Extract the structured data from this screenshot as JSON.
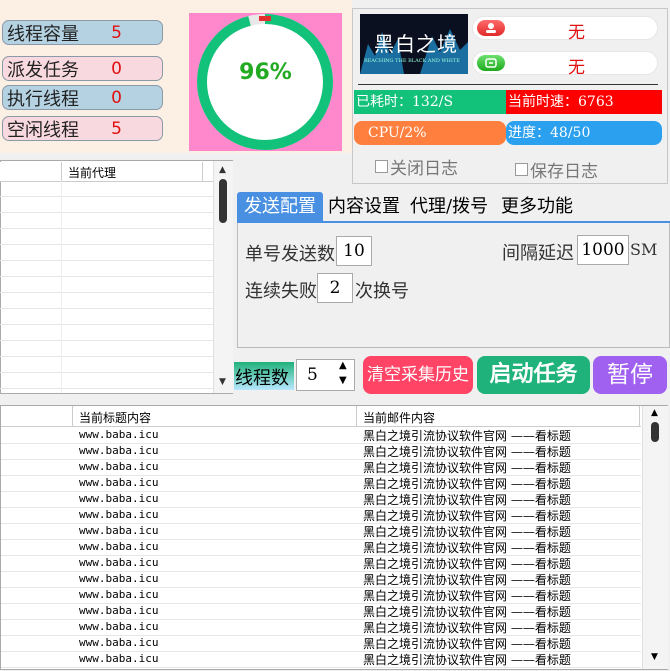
{
  "stats": {
    "capacity": {
      "label": "线程容量",
      "value": "5"
    },
    "dispatched": {
      "label": "派发任务",
      "value": "0"
    },
    "running": {
      "label": "执行线程",
      "value": "0"
    },
    "idle": {
      "label": "空闲线程",
      "value": "5"
    },
    "gauge_percent": "96%",
    "gauge_level": 0.96
  },
  "header": {
    "logo_text": "黑白之境",
    "logo_subtext": "REACHING THE BLACK AND WHITE",
    "status1": "无",
    "status2": "无",
    "elapsed": "已耗时：132/S",
    "speed": "当前时速：6763",
    "cpu": "CPU/2%",
    "progress": "进度：48/50",
    "close_log": "关闭日志",
    "save_log": "保存日志"
  },
  "proxy_list": {
    "col_header": "当前代理"
  },
  "tabs": [
    "发送配置",
    "内容设置",
    "代理/拨号",
    "更多功能"
  ],
  "send_config": {
    "per_account_label": "单号发送数",
    "per_account_value": "10",
    "interval_label": "间隔延迟",
    "interval_value": "1000",
    "interval_unit": "SM",
    "fail_label_pre": "连续失败",
    "fail_value": "2",
    "fail_label_post": "次换号"
  },
  "controls": {
    "threads_label": "线程数",
    "threads_value": "5",
    "clear_history": "清空采集历史",
    "start_task": "启动任务",
    "pause": "暂停"
  },
  "table": {
    "col_title": "当前标题内容",
    "col_mail": "当前邮件内容",
    "rows": [
      {
        "title": "www.baba.icu",
        "mail": "黑白之境引流协议软件官网 ——看标题"
      },
      {
        "title": "www.baba.icu",
        "mail": "黑白之境引流协议软件官网 ——看标题"
      },
      {
        "title": "www.baba.icu",
        "mail": "黑白之境引流协议软件官网 ——看标题"
      },
      {
        "title": "www.baba.icu",
        "mail": "黑白之境引流协议软件官网 ——看标题"
      },
      {
        "title": "www.baba.icu",
        "mail": "黑白之境引流协议软件官网 ——看标题"
      },
      {
        "title": "www.baba.icu",
        "mail": "黑白之境引流协议软件官网 ——看标题"
      },
      {
        "title": "www.baba.icu",
        "mail": "黑白之境引流协议软件官网 ——看标题"
      },
      {
        "title": "www.baba.icu",
        "mail": "黑白之境引流协议软件官网 ——看标题"
      },
      {
        "title": "www.baba.icu",
        "mail": "黑白之境引流协议软件官网 ——看标题"
      },
      {
        "title": "www.baba.icu",
        "mail": "黑白之境引流协议软件官网 ——看标题"
      },
      {
        "title": "www.baba.icu",
        "mail": "黑白之境引流协议软件官网 ——看标题"
      },
      {
        "title": "www.baba.icu",
        "mail": "黑白之境引流协议软件官网 ——看标题"
      },
      {
        "title": "www.baba.icu",
        "mail": "黑白之境引流协议软件官网 ——看标题"
      },
      {
        "title": "www.baba.icu",
        "mail": "黑白之境引流协议软件官网 ——看标题"
      },
      {
        "title": "www.baba.icu",
        "mail": "黑白之境引流协议软件官网 ——看标题"
      }
    ]
  },
  "colors": {
    "elapsed": "#13c27a",
    "speed": "#ff0000",
    "cpu": "#ff7f3f",
    "progress": "#2aa0ef",
    "gauge_ring": "#13c27a",
    "gauge_bg": "#ff88cc",
    "clear_btn": "#ff4466",
    "start_btn": "#1fb27a",
    "pause_btn": "#a060f0"
  }
}
